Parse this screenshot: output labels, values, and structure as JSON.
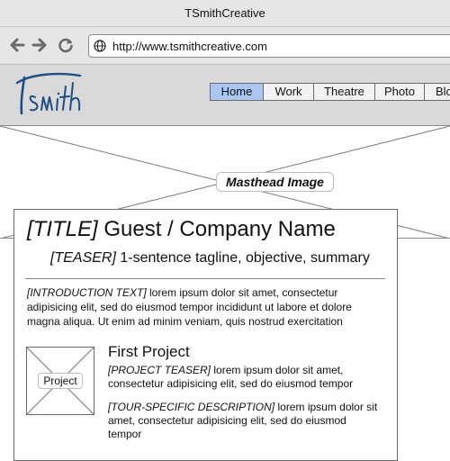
{
  "window": {
    "title": "TSmithCreative"
  },
  "browser": {
    "url": "http://www.tsmithcreative.com"
  },
  "site": {
    "logo_text": "tsmith",
    "menu": [
      {
        "label": "Home",
        "active": true
      },
      {
        "label": "Work",
        "active": false
      },
      {
        "label": "Theatre",
        "active": false
      },
      {
        "label": "Photo",
        "active": false
      },
      {
        "label": "Blog",
        "active": false
      }
    ]
  },
  "masthead": {
    "label": "Masthead Image"
  },
  "content": {
    "title_tag": "[TITLE]",
    "title_text": " Guest / Company Name",
    "teaser_tag": "[TEASER]",
    "teaser_text": " 1-sentence tagline, objective, summary",
    "intro_tag": "[INTRODUCTION TEXT]",
    "intro_text": " lorem ipsum dolor sit amet, consectetur adipisicing elit, sed do eiusmod tempor incididunt ut labore et dolore magna aliqua. Ut enim ad minim veniam, quis nostrud exercitation",
    "project": {
      "thumb_label": "Project",
      "title": "First Project",
      "teaser_tag": "[PROJECT TEASER]",
      "teaser_text": " lorem ipsum dolor sit amet, consectetur adipisicing elit, sed do eiusmod tempor",
      "desc_tag": "[TOUR-SPECIFIC DESCRIPTION]",
      "desc_text": " lorem ipsum dolor sit amet, consectetur adipisicing elit, sed do eiusmod tempor"
    }
  },
  "colors": {
    "active_menu": "#a9c7f2",
    "chrome": "#e6e6e6",
    "header": "#d9d9d9",
    "logo": "#1d4f86"
  }
}
